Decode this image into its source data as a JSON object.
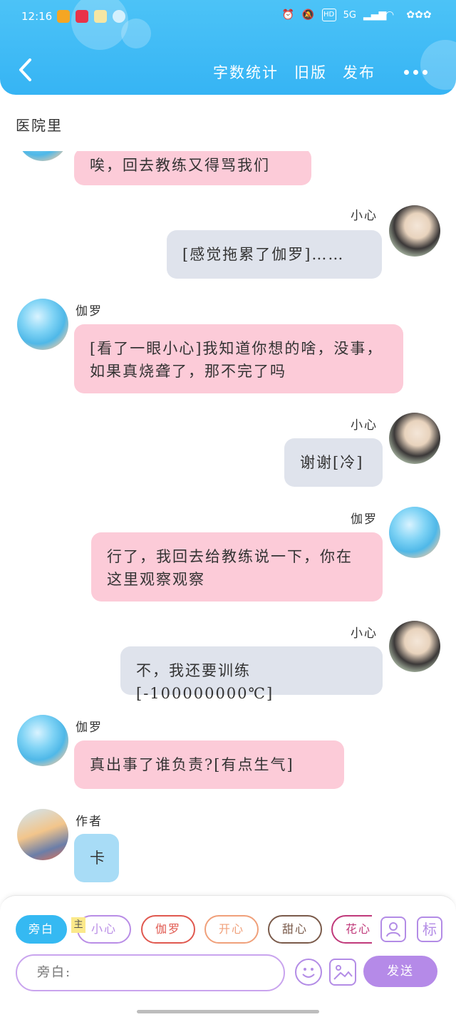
{
  "status_bar": {
    "time": "12:16",
    "app_colors": [
      "#f5a623",
      "#e8334a",
      "#f5e6a3",
      "#dde"
    ],
    "network": "5G",
    "hd": "HD"
  },
  "header": {
    "back_icon": "chevron-left-icon",
    "word_count": "字数统计",
    "old_version": "旧版",
    "publish": "发布",
    "more_icon": "more-dots-icon"
  },
  "scene_title": "医院里",
  "messages": [
    {
      "side": "left",
      "speaker": "",
      "avatar": "jialuo",
      "text": "唉，回去教练又得骂我们",
      "color": "pink"
    },
    {
      "side": "right",
      "speaker": "小心",
      "avatar": "xiaoxin",
      "text": "[感觉拖累了伽罗]……",
      "color": "gray"
    },
    {
      "side": "left",
      "speaker": "伽罗",
      "avatar": "jialuo",
      "text": "[看了一眼小心]我知道你想的啥，没事，如果真烧聋了，那不完了吗",
      "color": "pink"
    },
    {
      "side": "right",
      "speaker": "小心",
      "avatar": "xiaoxin",
      "text": "谢谢[冷]",
      "color": "gray"
    },
    {
      "side": "right",
      "speaker": "伽罗",
      "avatar": "jialuo",
      "text": "行了，我回去给教练说一下，你在这里观察观察",
      "color": "pink"
    },
    {
      "side": "right",
      "speaker": "小心",
      "avatar": "xiaoxin",
      "text": "不，我还要训练[-100000000℃]",
      "color": "gray"
    },
    {
      "side": "left",
      "speaker": "伽罗",
      "avatar": "jialuo",
      "text": "真出事了谁负责?[有点生气]",
      "color": "pink"
    },
    {
      "side": "left",
      "speaker": "作者",
      "avatar": "author",
      "text": "卡",
      "color": "blue"
    }
  ],
  "panel": {
    "characters": [
      {
        "label": "旁白",
        "color": "#35b9f2",
        "filled": true
      },
      {
        "label": "小心",
        "color": "#b98de6",
        "filled": false
      },
      {
        "label": "伽罗",
        "color": "#e0584f",
        "filled": false
      },
      {
        "label": "开心",
        "color": "#f0a07a",
        "filled": false
      },
      {
        "label": "甜心",
        "color": "#7a5a4a",
        "filled": false
      },
      {
        "label": "花心",
        "color": "#c0397a",
        "filled": false
      }
    ],
    "main_badge": "主",
    "tool_person_icon": "person-card-icon",
    "tool_mark": "标",
    "input_placeholder": "旁白:",
    "emoji_icon": "smiley-icon",
    "image_icon": "image-icon",
    "send": "发送"
  }
}
